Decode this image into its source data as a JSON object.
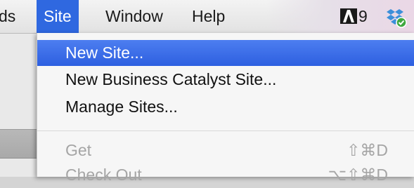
{
  "menubar": {
    "clipped_title": "ds",
    "items": [
      {
        "label": "Site"
      },
      {
        "label": "Window"
      },
      {
        "label": "Help"
      }
    ],
    "status": {
      "adobe_icon": "adobe-a-icon",
      "count": "9",
      "dropbox_icon": "dropbox-icon"
    }
  },
  "dropdown": {
    "items": [
      {
        "label": "New Site...",
        "shortcut": ""
      },
      {
        "label": "New Business Catalyst Site...",
        "shortcut": ""
      },
      {
        "label": "Manage Sites...",
        "shortcut": ""
      },
      {
        "label": "Get",
        "shortcut": "⇧⌘D"
      },
      {
        "label": "Check Out",
        "shortcut": "⌥⇧⌘D"
      }
    ]
  },
  "colors": {
    "menu_highlight": "#2f68e0",
    "disabled_text": "#a5a5a5"
  }
}
